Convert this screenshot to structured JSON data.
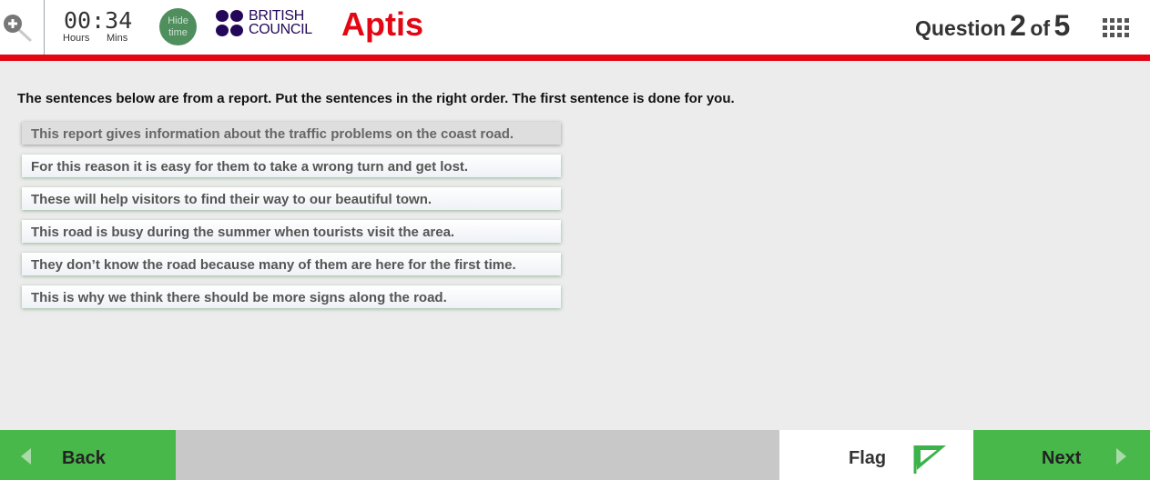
{
  "header": {
    "timer": {
      "value": "00:34",
      "hours_label": "Hours",
      "mins_label": "Mins"
    },
    "hide_time_label": "Hide time",
    "logo": {
      "line1": "BRITISH",
      "line2": "COUNCIL",
      "color": "#23085a"
    },
    "brand": "Aptis",
    "question": {
      "prefix": "Question",
      "current": "2",
      "of_label": "of",
      "total": "5"
    }
  },
  "main": {
    "instructions": "The sentences below are from a report. Put the sentences in the right order. The first sentence is done for you.",
    "sentences": [
      "This report gives information about the traffic problems on the coast road.",
      "For this reason it is easy for them to take a wrong turn and get lost.",
      "These will help visitors to find their way to our beautiful town.",
      "This road is busy during the summer when tourists visit the area.",
      "They don’t know the road because many of them are here for the first time.",
      "This is why we think there should be more signs along the road."
    ]
  },
  "footer": {
    "back_label": "Back",
    "flag_label": "Flag",
    "next_label": "Next"
  },
  "colors": {
    "accent_red": "#e30613",
    "button_green": "#49b84a",
    "brand_navy": "#23085a"
  }
}
